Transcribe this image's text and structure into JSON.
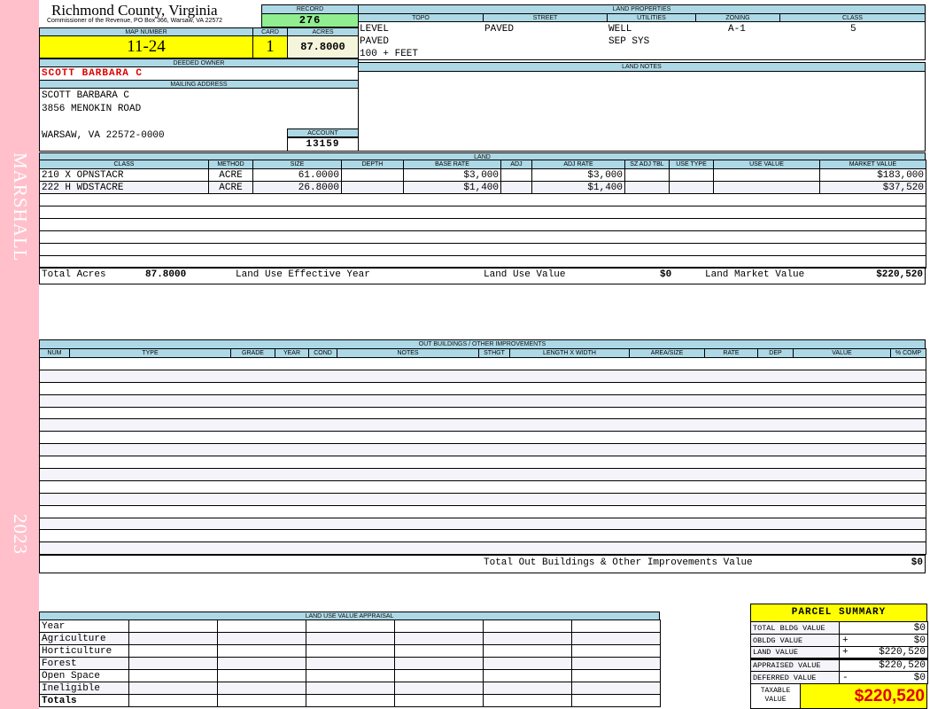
{
  "sidebar": {
    "district": "MARSHALL",
    "year": "2023"
  },
  "header": {
    "county": "Richmond County, Virginia",
    "subtitle": "Commissioner of the Revenue, PO Box 366, Warsaw, VA 22572"
  },
  "record": {
    "label": "RECORD",
    "value": "276"
  },
  "map": {
    "label": "MAP NUMBER",
    "value": "11-24"
  },
  "card": {
    "label": "CARD",
    "value": "1"
  },
  "acres": {
    "label": "ACRES",
    "value": "87.8000"
  },
  "owner": {
    "label": "DEEDED OWNER",
    "value": "SCOTT BARBARA C"
  },
  "mailing": {
    "label": "MAILING ADDRESS",
    "line1": "SCOTT BARBARA C",
    "line2": "3856 MENOKIN ROAD",
    "line3": "WARSAW, VA 22572-0000"
  },
  "account": {
    "label": "ACCOUNT",
    "value": "13159"
  },
  "land_properties": {
    "title": "LAND PROPERTIES",
    "headers": [
      "TOPO",
      "STREET",
      "UTILITIES",
      "ZONING",
      "CLASS"
    ],
    "topo": [
      "LEVEL",
      "PAVED",
      "100 + FEET"
    ],
    "street": "PAVED",
    "utilities": [
      "WELL",
      "SEP SYS"
    ],
    "zoning": "A-1",
    "class": "5"
  },
  "land_notes": {
    "title": "LAND NOTES"
  },
  "land": {
    "title": "LAND",
    "headers": [
      "CLASS",
      "METHOD",
      "SIZE",
      "DEPTH",
      "BASE RATE",
      "ADJ",
      "ADJ RATE",
      "SZ ADJ TBL",
      "USE TYPE",
      "USE VALUE",
      "MARKET VALUE"
    ],
    "rows": [
      [
        "210 X OPNSTACR",
        "ACRE",
        "61.0000",
        "",
        "$3,000",
        "",
        "$3,000",
        "",
        "",
        "",
        "$183,000"
      ],
      [
        "222 H WDSTACRE",
        "ACRE",
        "26.8000",
        "",
        "$1,400",
        "",
        "$1,400",
        "",
        "",
        "",
        "$37,520"
      ]
    ],
    "total_acres_label": "Total Acres",
    "total_acres": "87.8000",
    "effective_year_label": "Land Use Effective Year",
    "use_value_label": "Land Use Value",
    "use_value": "$0",
    "market_value_label": "Land Market Value",
    "market_value": "$220,520"
  },
  "outbuildings": {
    "title": "OUT BUILDINGS / OTHER IMPROVEMENTS",
    "headers": [
      "NUM",
      "TYPE",
      "GRADE",
      "YEAR",
      "COND",
      "NOTES",
      "STHGT",
      "LENGTH X WIDTH",
      "AREA/SIZE",
      "RATE",
      "DEP",
      "VALUE",
      "% COMP"
    ],
    "total_label": "Total Out Buildings & Other Improvements Value",
    "total": "$0"
  },
  "land_use": {
    "title": "LAND USE VALUE APPRAISAL",
    "year_label": "Year",
    "rows": [
      "Agriculture",
      "Horticulture",
      "Forest",
      "Open Space",
      "Ineligible"
    ],
    "totals_label": "Totals"
  },
  "parcel_summary": {
    "title": "PARCEL SUMMARY",
    "rows": [
      {
        "label": "TOTAL BLDG VALUE",
        "op": "",
        "value": "$0"
      },
      {
        "label": "OBLDG VALUE",
        "op": "+",
        "value": "$0"
      },
      {
        "label": "LAND VALUE",
        "op": "+",
        "value": "$220,520"
      },
      {
        "label": "APPRAISED VALUE",
        "op": "",
        "value": "$220,520"
      },
      {
        "label": "DEFERRED VALUE",
        "op": "-",
        "value": "$0"
      }
    ],
    "taxable_label": "TAXABLE VALUE",
    "taxable": "$220,520"
  },
  "colors": {
    "header_blue": "#add8e6",
    "highlight_yellow": "#ffff00",
    "record_green": "#90ee90",
    "owner_red": "#e00000",
    "sidebar_pink": "#ffc0cb"
  }
}
